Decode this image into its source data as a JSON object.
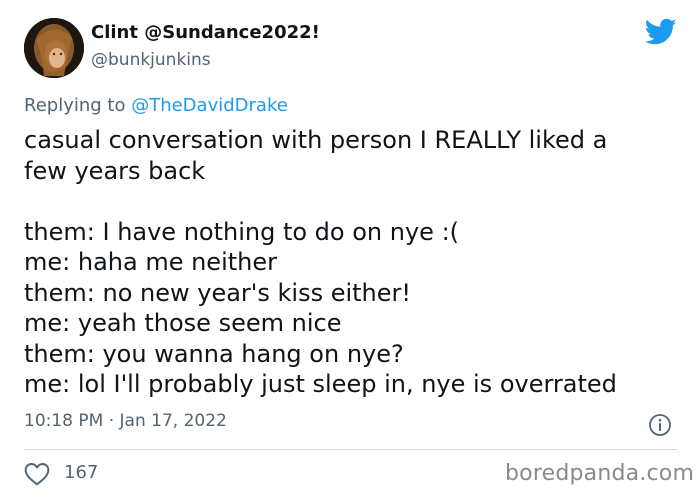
{
  "author": {
    "display_name": "Clint @Sundance2022!",
    "handle": "@bunkjunkins",
    "avatar_icon": "user-avatar-photo"
  },
  "brand": {
    "icon": "twitter-bird-icon",
    "color": "#1d9bf0"
  },
  "reply": {
    "prefix": "Replying to ",
    "mention": "@TheDavidDrake"
  },
  "tweet": {
    "intro": [
      "casual conversation with person I REALLY liked a",
      "few years back"
    ],
    "dialogue": [
      "them: I have nothing to do on nye :(",
      "me: haha me neither",
      "them: no new year's kiss either!",
      "me: yeah those seem nice",
      "them: you wanna hang on nye?",
      "me: lol I'll probably just sleep in, nye is overrated"
    ]
  },
  "meta": {
    "timestamp": "10:18 PM · Jan 17, 2022",
    "info_icon": "info-icon"
  },
  "engagement": {
    "like_icon": "heart-icon",
    "like_count": "167"
  },
  "watermark": "boredpanda.com",
  "colors": {
    "text": "#0f1419",
    "secondary": "#536471",
    "link": "#1d9bf0",
    "divider": "#cfd9de"
  }
}
